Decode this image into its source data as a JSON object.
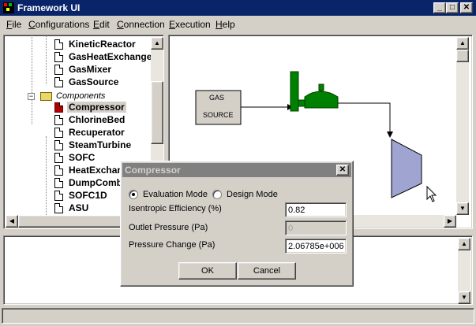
{
  "window": {
    "title": "Framework UI"
  },
  "menu": [
    {
      "label": "File",
      "u": "F",
      "rest": "ile"
    },
    {
      "label": "Configurations",
      "u": "C",
      "rest": "onfigurations"
    },
    {
      "label": "Edit",
      "u": "E",
      "rest": "dit"
    },
    {
      "label": "Connection",
      "u": "C",
      "rest": "onnection"
    },
    {
      "label": "Execution",
      "u": "E",
      "rest": "xecution"
    },
    {
      "label": "Help",
      "u": "H",
      "rest": "elp"
    }
  ],
  "tree": {
    "items_top": [
      "KineticReactor",
      "GasHeatExchanger",
      "GasMixer",
      "GasSource"
    ],
    "folder": {
      "label": "Components",
      "toggle": "−"
    },
    "items_components": [
      "Compressor",
      "ChlorineBed",
      "Recuperator",
      "SteamTurbine",
      "SOFC",
      "HeatExchanger",
      "DumpCombustor",
      "SOFC1D",
      "ASU"
    ],
    "selected": "Compressor"
  },
  "canvas": {
    "gas_source": {
      "line1": "GAS",
      "line2": "SOURCE"
    },
    "colors": {
      "equipment": "#008000",
      "compressor": "#a0a4d0"
    }
  },
  "dialog": {
    "title": "Compressor",
    "mode_eval": "Evaluation Mode",
    "mode_design": "Design Mode",
    "selected_mode": "Evaluation Mode",
    "fields": [
      {
        "label": "Isentropic Efficiency (%)",
        "value": "0.82",
        "disabled": false
      },
      {
        "label": "Outlet Pressure (Pa)",
        "value": "0",
        "disabled": true
      },
      {
        "label": "Pressure Change (Pa)",
        "value": "2.06785e+006",
        "disabled": false
      }
    ],
    "ok": "OK",
    "cancel": "Cancel"
  },
  "icons": [
    "app-icon",
    "minimize-icon",
    "maximize-icon",
    "close-icon",
    "folder-icon",
    "component-icon",
    "pointer-cursor-icon"
  ]
}
